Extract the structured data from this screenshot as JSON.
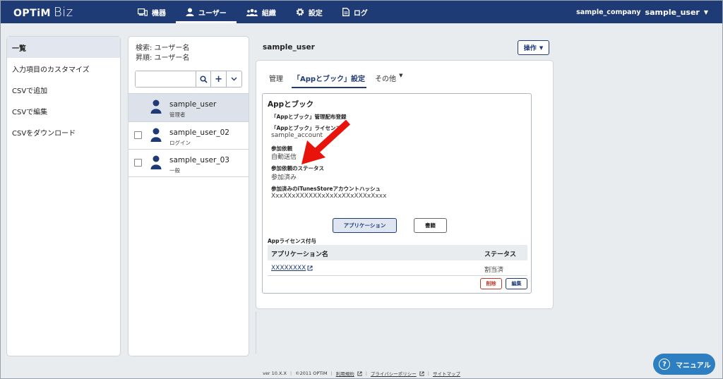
{
  "logo": {
    "brand": "OPTiM",
    "product": "Biz"
  },
  "nav": {
    "items": [
      {
        "label": "機器",
        "icon": "device-icon"
      },
      {
        "label": "ユーザー",
        "icon": "user-icon"
      },
      {
        "label": "組織",
        "icon": "group-icon"
      },
      {
        "label": "設定",
        "icon": "gear-icon"
      },
      {
        "label": "ログ",
        "icon": "document-icon"
      }
    ],
    "active": "ユーザー"
  },
  "account": {
    "company": "sample_company",
    "user": "sample_user"
  },
  "left_menu": {
    "items": [
      "一覧",
      "入力項目のカスタマイズ",
      "CSVで追加",
      "CSVで編集",
      "CSVをダウンロード"
    ],
    "active_index": 0
  },
  "user_list": {
    "search_line": "検索: ユーザー名",
    "sort_line": "昇順: ユーザー名",
    "search_placeholder": "",
    "users": [
      {
        "name": "sample_user",
        "role": "管理者",
        "selected": true
      },
      {
        "name": "sample_user_02",
        "role": "ログイン",
        "selected": false
      },
      {
        "name": "sample_user_03",
        "role": "一般",
        "selected": false
      }
    ]
  },
  "main": {
    "title": "sample_user",
    "operation_button": "操作",
    "tabs": [
      {
        "label": "管理"
      },
      {
        "label": "「Appとブック」設定"
      },
      {
        "label": "その他"
      }
    ],
    "active_tab_index": 1
  },
  "card": {
    "title": "Appとブック",
    "fields": {
      "section_label": "「Appとブック」管理配布登録",
      "license_label": "「Appとブック」ライセンス",
      "license_value": "sample_account",
      "request_label": "参加依頼",
      "request_value": "自動送信",
      "status_label": "参加依頼のステータス",
      "status_value": "参加済み",
      "hash_label": "参加済みのiTunesStoreアカウントハッシュ",
      "hash_value": "XxxXXxXXXXXXxXxXxXXxXXXxXxxx"
    },
    "app_button": "アプリケーション",
    "doc_button": "書籍",
    "license_section": "Appライセンス付与",
    "table": {
      "headers": [
        "アプリケーション名",
        "ステータス"
      ],
      "rows": [
        {
          "name": "XXXXXXXX",
          "status": "割当済"
        }
      ]
    },
    "delete_button": "削除",
    "edit_button": "編集"
  },
  "footer": {
    "version": "ver 10.X.X",
    "copyright": "©2011 OPTiM",
    "links": [
      "利用規約",
      "プライバシーポリシー",
      "サイトマップ"
    ]
  },
  "manual_button": "マニュアル",
  "colors": {
    "nav": "#1f3b76",
    "accent": "#1f3b76",
    "manual": "#2d7fc1",
    "danger": "#c0392b"
  }
}
